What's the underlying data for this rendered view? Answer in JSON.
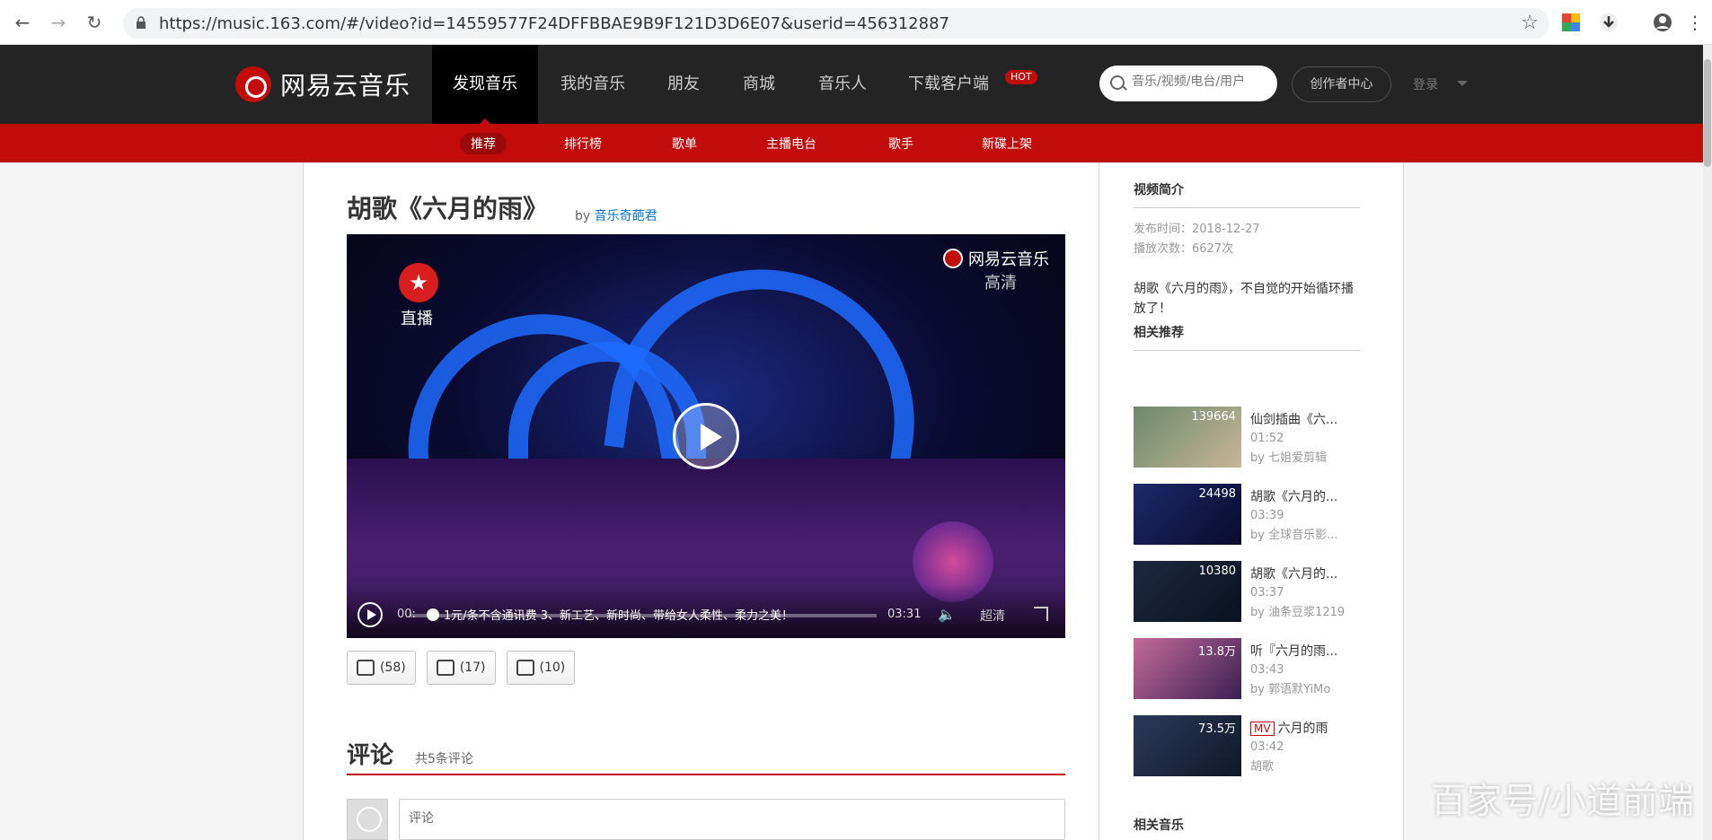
{
  "browser": {
    "url": "https://music.163.com/#/video?id=14559577F24DFFBBAE9B9F121D3D6E07&userid=456312887"
  },
  "nav": {
    "brand": "网易云音乐",
    "items": [
      "发现音乐",
      "我的音乐",
      "朋友",
      "商城",
      "音乐人",
      "下载客户端"
    ],
    "hot": "HOT",
    "search_placeholder": "音乐/视频/电台/用户",
    "creator": "创作者中心",
    "login": "登录"
  },
  "subnav": [
    "推荐",
    "排行榜",
    "歌单",
    "主播电台",
    "歌手",
    "新碟上架"
  ],
  "video": {
    "title": "胡歌《六月的雨》",
    "by_prefix": "by",
    "author": "音乐奇葩君",
    "watermark_brand": "网易云音乐",
    "quality_tag": "高清",
    "live_tag": "直播",
    "time_current": "00:",
    "time_total": "03:31",
    "subtitle": "1元/条不含通讯费    3、新工艺、新时尚、带给女人柔性、柔力之美！",
    "quality": "超清",
    "progress": 0.05
  },
  "actions": {
    "like": "(58)",
    "collect": "(17)",
    "share": "(10)"
  },
  "comments": {
    "title": "评论",
    "count": "共5条评论",
    "placeholder": "评论"
  },
  "sidebar": {
    "intro_title": "视频简介",
    "publish": "发布时间：2018-12-27",
    "plays": "播放次数：6627次",
    "description": "胡歌《六月的雨》，不自觉的开始循环播放了！",
    "recommend_title": "相关推荐",
    "related_music_title": "相关音乐",
    "recommendations": [
      {
        "count": "139664",
        "title": "仙剑插曲《六...",
        "duration": "01:52",
        "author": "by 七姐爱剪辑",
        "mv": false
      },
      {
        "count": "24498",
        "title": "胡歌《六月的...",
        "duration": "03:39",
        "author": "by 全球音乐影...",
        "mv": false
      },
      {
        "count": "10380",
        "title": "胡歌《六月的...",
        "duration": "03:37",
        "author": "by 油条豆浆1219",
        "mv": false
      },
      {
        "count": "13.8万",
        "title": "听『六月的雨...",
        "duration": "03:43",
        "author": "by 郭语默YiMo",
        "mv": false
      },
      {
        "count": "73.5万",
        "title": "六月的雨",
        "duration": "03:42",
        "author": "胡歌",
        "mv": true,
        "mv_label": "MV"
      }
    ]
  },
  "page_watermark": "百家号/小道前端",
  "colors": {
    "brand_red": "#c20c0c",
    "nav_dark": "#242424",
    "link_blue": "#0c73c2"
  }
}
